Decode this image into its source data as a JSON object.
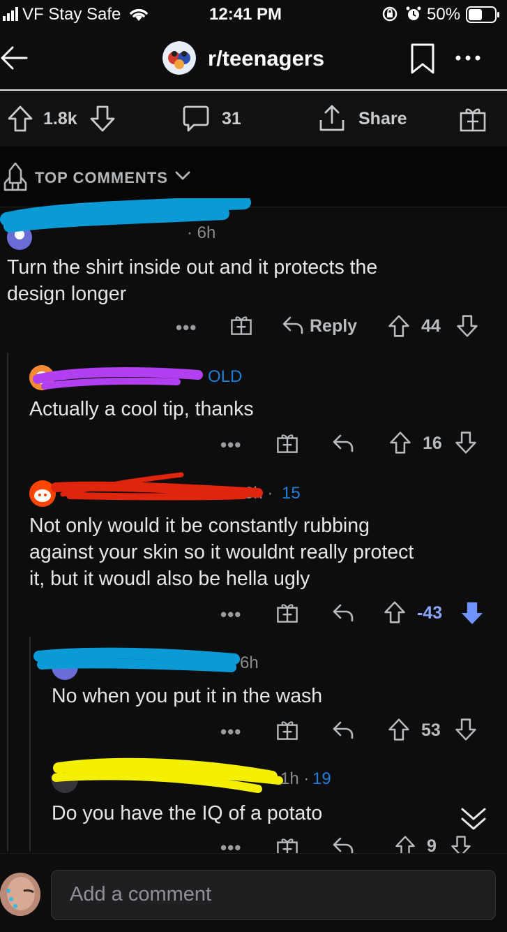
{
  "status_bar": {
    "carrier": "VF Stay Safe",
    "time": "12:41 PM",
    "battery": "50%"
  },
  "header": {
    "subreddit": "r/teenagers"
  },
  "post_actions": {
    "upvotes": "1.8k",
    "comments": "31",
    "share_label": "Share"
  },
  "sort": {
    "label": "TOP COMMENTS"
  },
  "comments": [
    {
      "author_redacted": true,
      "redaction_color": "#0a9bd6",
      "time": "6h",
      "flair": "",
      "body_lines": [
        "Turn the shirt inside out and it protects the",
        "design longer"
      ],
      "reply_label": "Reply",
      "score": "44",
      "vote_state": "none"
    },
    {
      "author_redacted": true,
      "redaction_color": "#b33ff2",
      "time": "",
      "flair": "OLD",
      "body_lines": [
        "Actually a cool tip, thanks"
      ],
      "score": "16",
      "vote_state": "none"
    },
    {
      "author_redacted": true,
      "redaction_color": "#e0250e",
      "time": "6h",
      "flair": "15",
      "body_lines": [
        "Not only would it be constantly rubbing",
        "against your skin so it wouldnt really protect",
        "it, but it woudl also be hella ugly"
      ],
      "score": "-43",
      "vote_state": "downvoted"
    },
    {
      "author_redacted": true,
      "redaction_color": "#0a9bd6",
      "time": "6h",
      "flair": "",
      "body_lines": [
        "No when you put it in the wash"
      ],
      "score": "53",
      "vote_state": "none"
    },
    {
      "author_redacted": true,
      "redaction_color": "#f5f000",
      "time": "1h",
      "flair": "19",
      "body_lines": [
        "Do you have the IQ of a potato"
      ],
      "score": "9",
      "vote_state": "none"
    }
  ],
  "composer": {
    "placeholder": "Add a comment"
  },
  "colors": {
    "background": "#0d0d0e",
    "flair_blue": "#1e7fd8",
    "downvote_blue": "#7193ff"
  }
}
